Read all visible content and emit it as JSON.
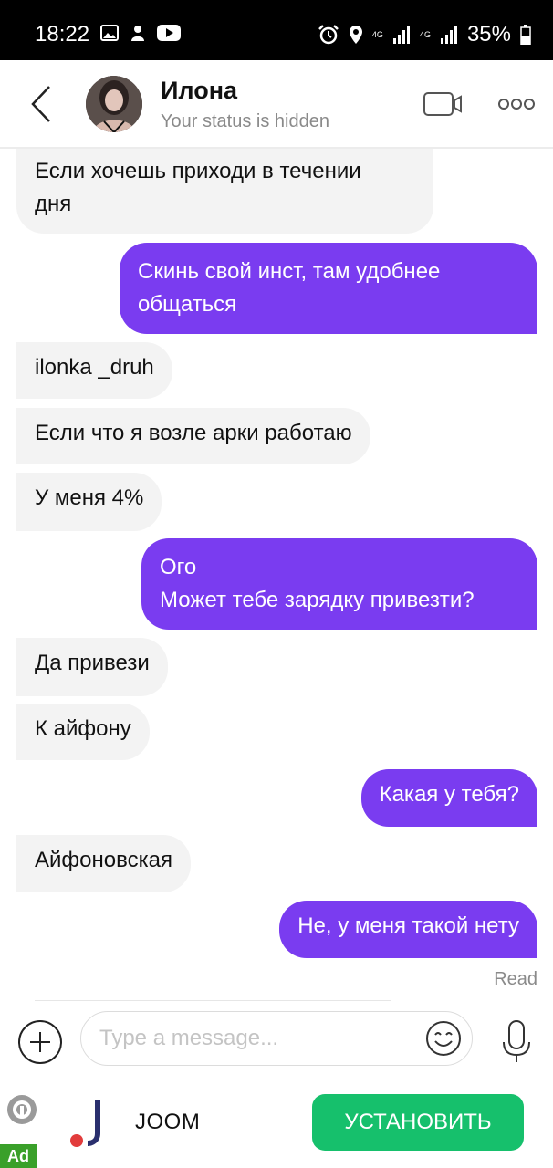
{
  "status_bar": {
    "time": "18:22",
    "network_1": "4G",
    "network_2": "4G",
    "battery": "35%",
    "left_icons": [
      "image-icon",
      "app-notification-icon",
      "youtube-icon"
    ],
    "right_icons": [
      "alarm-icon",
      "location-icon",
      "signal-icon",
      "signal-icon",
      "battery-icon"
    ]
  },
  "header": {
    "contact_name": "Илона",
    "status": "Your status is hidden",
    "icons": [
      "back-arrow-icon",
      "video-camera-icon",
      "more-dots-icon"
    ]
  },
  "messages": [
    {
      "direction": "in",
      "text": "Если хочешь приходи в течении\nдня"
    },
    {
      "direction": "out",
      "text": "Скинь свой инст, там удобнее\nобщаться"
    },
    {
      "direction": "in",
      "text": "ilonka _druh"
    },
    {
      "direction": "in",
      "text": "Если что я возле арки работаю"
    },
    {
      "direction": "in",
      "text": "У меня 4%"
    },
    {
      "direction": "out",
      "text": "Ого\nМожет тебе зарядку привезти?"
    },
    {
      "direction": "in",
      "text": "Да привези"
    },
    {
      "direction": "in",
      "text": "К айфону"
    },
    {
      "direction": "out",
      "text": "Какая у тебя?"
    },
    {
      "direction": "in",
      "text": "Айфоновская"
    },
    {
      "direction": "out",
      "text": "Не, у меня такой нету"
    }
  ],
  "read_receipt": "Read",
  "composer": {
    "placeholder": "Type a message...",
    "icons": [
      "plus-icon",
      "emoji-icon",
      "microphone-icon"
    ]
  },
  "ad": {
    "badge": "Ad",
    "brand": "JOOM",
    "install_label": "УСТАНОВИТЬ",
    "colors": {
      "install": "#16c06c",
      "badge": "#3aa02a"
    }
  },
  "colors": {
    "outgoing_bubble": "#7a3cf0",
    "incoming_bubble": "#f3f3f3",
    "status_bar": "#000000"
  }
}
